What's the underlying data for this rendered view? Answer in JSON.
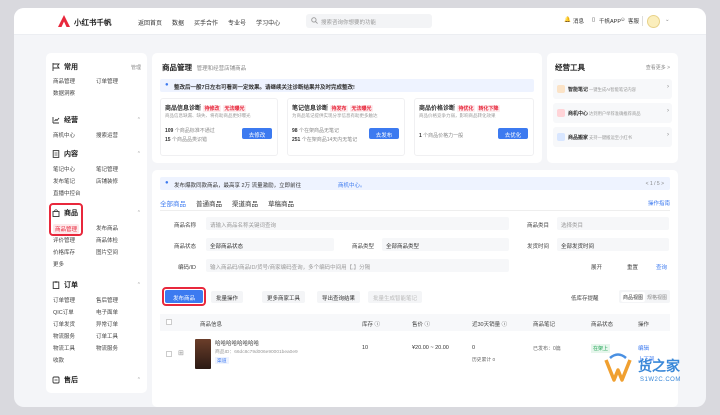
{
  "app": {
    "name": "小红书千帆"
  },
  "nav": [
    "返回首页",
    "数据",
    "买手合作",
    "专业号",
    "学习中心"
  ],
  "search": {
    "placeholder": "搜索咨询你想要的功能"
  },
  "topright": {
    "messages": "消息",
    "app": "千帆APP",
    "service": "客服"
  },
  "sidebar": {
    "sections": [
      {
        "title": "常用",
        "right": "管理",
        "items": [
          "商品管理",
          "订单管理",
          "数据洞察"
        ]
      },
      {
        "title": "经营",
        "right": "^",
        "items": [
          "商机中心",
          "搜索运营"
        ]
      },
      {
        "title": "内容",
        "right": "^",
        "items": [
          "笔记中心",
          "笔记管理",
          "发布笔记",
          "店铺装修",
          "直播中控台"
        ]
      },
      {
        "title": "商品",
        "right": "^",
        "items": [
          "商品管理",
          "发布商品",
          "评价管理",
          "商品体检",
          "价格库存",
          "图片空间",
          "更多"
        ]
      },
      {
        "title": "订单",
        "right": "^",
        "items": [
          "订单管理",
          "售后管理",
          "QIC订单",
          "电子面单",
          "订单发货",
          "异常订单",
          "物流服务",
          "订单工具",
          "物流工具",
          "物流服务",
          "收款"
        ]
      },
      {
        "title": "售后",
        "right": "^",
        "items": []
      }
    ]
  },
  "main": {
    "title": "商品管理",
    "subtitle": "管理和经营店铺商品",
    "alert": "整改后一般7日左右可看到一定效果。请继续关注诊断结果并及时完成整改!",
    "diag": [
      {
        "name": "商品信息诊断",
        "tag1": "待修改",
        "tag2": "无法曝光",
        "desc": "商品信息缺漏、缺失、将有助商品更好曝光",
        "l1n": "109",
        "l1": "个商品标准不通过",
        "l2n": "15",
        "l2": "个商品品类识错",
        "btn": "去修改"
      },
      {
        "name": "笔记信息诊断",
        "tag1": "待发布",
        "tag2": "无法曝光",
        "desc": "为商品笔记提供实现分享信息有助更多触达",
        "l1n": "98",
        "l1": "个在架商品无笔记",
        "l2n": "251",
        "l2": "个在架商品14天内无笔记",
        "btn": "去发布"
      },
      {
        "name": "商品价格诊断",
        "tag1": "待优化",
        "tag2": "转化下降",
        "desc": "商品价格竞争力弱，影响商品转化效果",
        "l1n": "1",
        "l1": "个商品价格力一般",
        "l2n": "",
        "l2": "",
        "btn": "去优化"
      }
    ],
    "tools_title": "经营工具",
    "tools_more": "查看更多 >",
    "tools": [
      {
        "name": "智能笔记",
        "desc": "一键生成AI智能笔记内容"
      },
      {
        "name": "商机中心",
        "desc": "达到用户举荐准确推荐商品"
      },
      {
        "name": "商品搬家",
        "desc": "支持一键搬运至小红书"
      }
    ],
    "notice": "发布爆款同款商品，最高享 2万 流量激励，立即前往",
    "notice_link": "商机中心。",
    "notice_page": "< 1 / 5 >",
    "tabs": [
      "全部商品",
      "普通商品",
      "渠道商品",
      "草稿商品"
    ],
    "guide": "操作指南",
    "filters": {
      "name_label": "商品名称",
      "name_ph": "请输入商品名称关键词查询",
      "cat_label": "商品类目",
      "cat_ph": "选择类目",
      "status_label": "商品状态",
      "status_val": "全部商品状态",
      "type_label": "商品类型",
      "type_val": "全部商品类型",
      "ship_label": "发货时间",
      "ship_val": "全部发货时间",
      "code_label": "编码/ID",
      "code_ph": "输入商品码/商品ID/货号/商家编码查询，多个编码中间用【,】分隔",
      "expand": "展开",
      "reset": "重置",
      "query": "查询"
    },
    "actions": {
      "publish": "发布商品",
      "batch": "批量操作",
      "multi": "更多商家工具",
      "export": "导出查询结果",
      "quick": "批量生成智能笔记",
      "low_stock": "低库存提醒",
      "view1": "商品视图",
      "view2": "规格视图"
    },
    "table": {
      "headers": [
        "商品信息",
        "库存 ⓘ",
        "售价 ⓘ",
        "近30天销量 ⓘ",
        "商品笔记",
        "商品状态",
        "操作"
      ],
      "row": {
        "name": "哈哈哈哈哈哈哈哈",
        "id": "商品ID：66dc8c79d006e90001bea0e9",
        "badge": "渠道",
        "stock": "10",
        "price": "¥20.00 ~ 20.00",
        "sales": "0",
        "sales_sub": "历史累计 0",
        "notes": "已发布：0篇",
        "status": "在架上",
        "ops": [
          "编辑",
          "上下架"
        ]
      }
    }
  },
  "watermark": {
    "text": "货之家",
    "sub": "S1W2C.COM"
  }
}
